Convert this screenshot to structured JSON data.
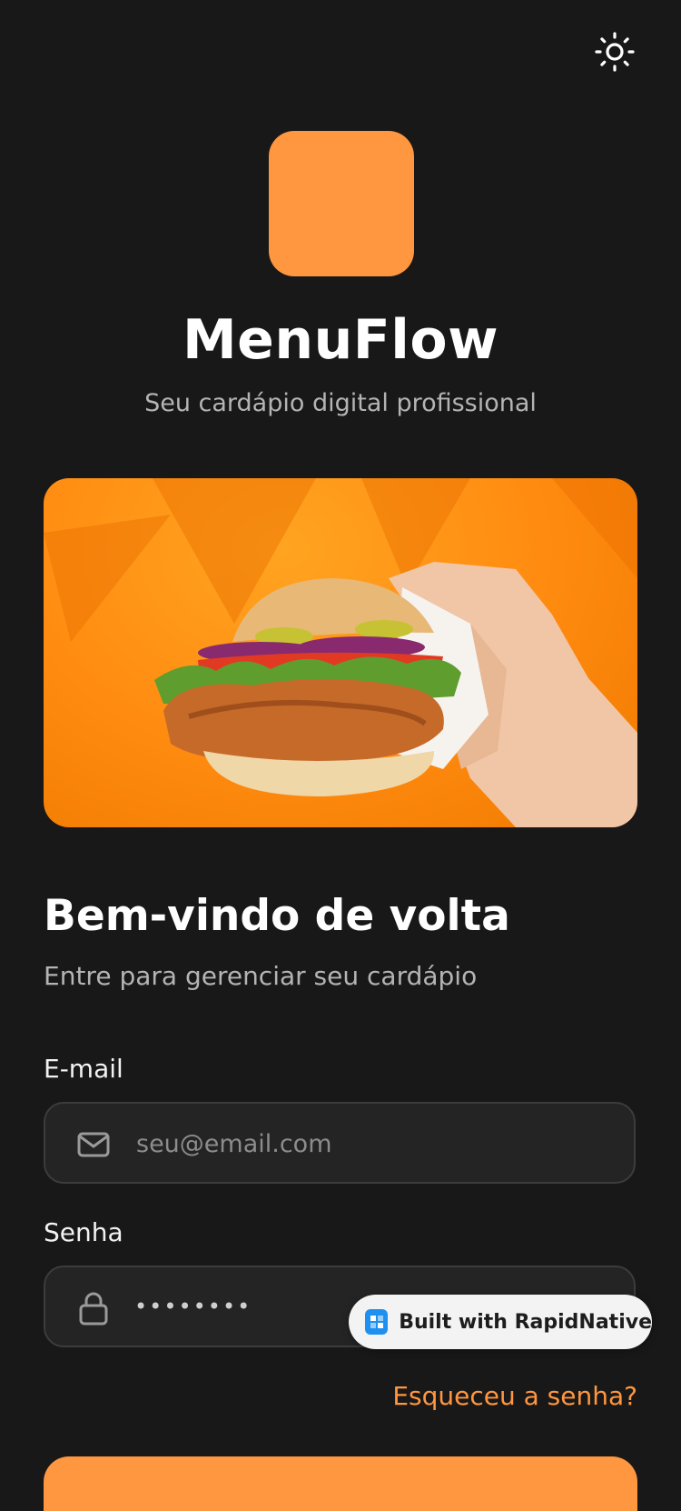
{
  "app": {
    "title": "MenuFlow",
    "subtitle": "Seu cardápio digital profissional",
    "accent_color": "#FF9640",
    "background_color": "#181818"
  },
  "header": {
    "theme_toggle_icon": "sun-icon"
  },
  "hero": {
    "image_description_icon": "burger-image"
  },
  "login": {
    "heading": "Bem-vindo de volta",
    "subheading": "Entre para gerenciar seu cardápio",
    "email": {
      "label": "E-mail",
      "placeholder": "seu@email.com",
      "value": "",
      "icon": "mail-icon"
    },
    "password": {
      "label": "Senha",
      "masked_value": "••••••••",
      "icon": "lock-icon"
    },
    "forgot_link": "Esqueceu a senha?"
  },
  "badge": {
    "label": "Built with RapidNative",
    "icon": "rapidnative-icon"
  }
}
